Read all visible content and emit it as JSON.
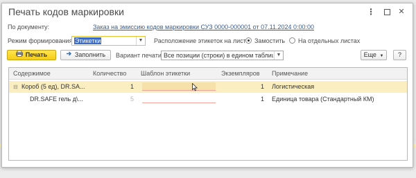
{
  "window": {
    "title": "Печать кодов маркировки",
    "menu_icon": "more-vertical-icon",
    "maximize_icon": "maximize-icon",
    "close_icon": "close-icon"
  },
  "document": {
    "label": "По документу:",
    "link": "Заказ на эмиссию кодов маркировки СУЗ 0000-000001 от 07.11.2024 0:00:00"
  },
  "mode": {
    "label": "Режим формирования:",
    "value": "Этикетки"
  },
  "layout": {
    "label": "Расположение этикеток на листе:",
    "options": [
      {
        "label": "Замостить",
        "selected": true
      },
      {
        "label": "На отдельных листах",
        "selected": false
      }
    ]
  },
  "toolbar": {
    "print_label": "Печать",
    "fill_label": "Заполнить",
    "print_variant_label": "Вариант печати:",
    "print_variant_value": "Все позиции (строки) в едином таблицы",
    "more_label": "Еще",
    "help_label": "?"
  },
  "table": {
    "columns": [
      "Содержимое",
      "Количество",
      "Шаблон этикетки",
      "Экземпляров",
      "Примечание"
    ],
    "rows": [
      {
        "content": "Короб (5 ед), DR.SA...",
        "quantity": "1",
        "template": "",
        "copies": "1",
        "note": "Логистическая",
        "selected": true
      },
      {
        "content": "DR.SAFE гель д\\...",
        "quantity": "5",
        "template": "",
        "copies": "1",
        "note": "Единица товара (Стандартный КМ)",
        "selected": false
      }
    ]
  },
  "colors": {
    "primary_button": "#f5cd17",
    "link": "#3c5e8f",
    "selected_row": "#fbeec0",
    "text_selection": "#3c6bc5"
  }
}
